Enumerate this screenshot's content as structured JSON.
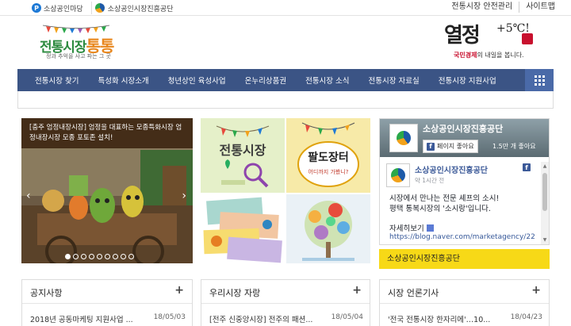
{
  "topbar": {
    "links": [
      {
        "icon": "portal-icon",
        "label": "소상공인마당"
      },
      {
        "icon": "semas-logo-icon",
        "label": "소상공인시장진흥공단"
      }
    ],
    "right": [
      "전통시장 안전관리",
      "사이트맵"
    ]
  },
  "logo": {
    "main": "전통시장",
    "accent": "통통",
    "sub": "정과 추억을 사고 파는 그 곳"
  },
  "slogan": {
    "main": "열정",
    "sup": "+5℃!",
    "sub_highlight": "국민경제",
    "sub_rest": "의 내일을 봅니다."
  },
  "nav": {
    "items": [
      "전통시장 찾기",
      "특성화 시장소개",
      "청년상인 육성사업",
      "온누리상품권",
      "전통시장 소식",
      "전통시장 자료실",
      "전통시장 지원사업"
    ]
  },
  "slider": {
    "caption": "[충주 엄정내장시장] 엄정을 대표하는 모종특화시장 엄정내장시장 모종 포토존 설치!",
    "prev": "‹",
    "next": "›",
    "dots": 9,
    "active_dot": 0
  },
  "tiles": {
    "t1": "전통시장",
    "t2_title": "팔도장터",
    "t2_sub": "어디까지 가봤니?"
  },
  "facebook": {
    "page_name": "소상공인시장진흥공단",
    "like_label": "페이지 좋아요",
    "likes": "1.5만 개 좋아요",
    "post_name": "소상공인시장진흥공단",
    "post_time": "약 1시간 전",
    "post_line1": "시장에서 만나는 전문 셰프의 소시!",
    "post_line2": "평택 통복시장의 '소시랑'입니다.",
    "more": "자세히보기",
    "url": "https://blog.naver.com/marketagency/22"
  },
  "banner": {
    "label": "소상공인시장진흥공단"
  },
  "boxes": [
    {
      "title": "공지사항",
      "plus": "+",
      "row": "2018년 공동마케팅 지원사업 ...",
      "date": "18/05/03"
    },
    {
      "title": "우리시장 자랑",
      "plus": "+",
      "row": "[전주 신중앙시장] 전주의 패션...",
      "date": "18/05/04"
    },
    {
      "title": "시장 언론기사",
      "plus": "+",
      "row": "'전국 전통시장 한자리에'…10...",
      "date": "18/04/23"
    }
  ],
  "colors": {
    "nav": "#3b5485",
    "nav_grid": "#4a6aa8",
    "banner": "#f7d917",
    "fb_blue": "#3b5998"
  }
}
